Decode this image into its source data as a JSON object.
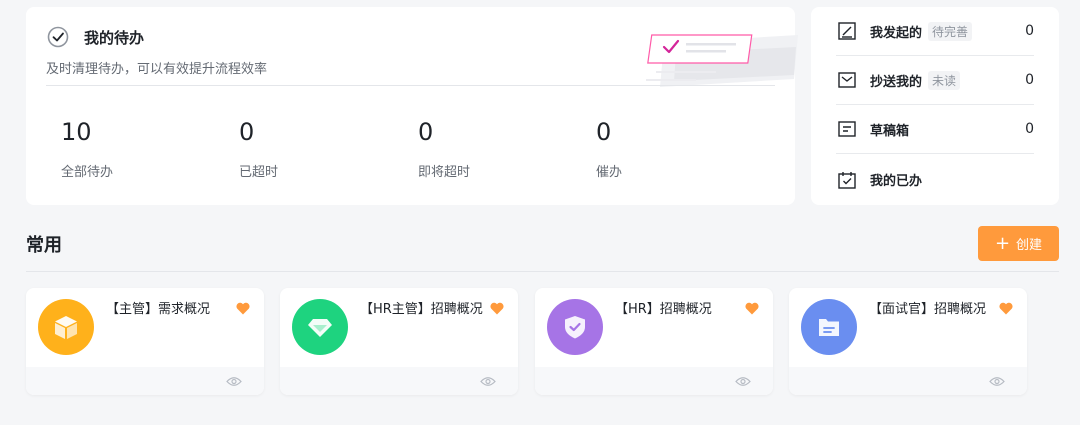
{
  "todo": {
    "title": "我的待办",
    "subtitle": "及时清理待办，可以有效提升流程效率",
    "stats": [
      {
        "value": "10",
        "label": "全部待办"
      },
      {
        "value": "0",
        "label": "已超时"
      },
      {
        "value": "0",
        "label": "即将超时"
      },
      {
        "value": "0",
        "label": "催办"
      }
    ]
  },
  "side": {
    "items": [
      {
        "label": "我发起的",
        "tag": "待完善",
        "count": "0",
        "icon": "edit-icon"
      },
      {
        "label": "抄送我的",
        "tag": "未读",
        "count": "0",
        "icon": "mail-icon"
      },
      {
        "label": "草稿箱",
        "tag": "",
        "count": "0",
        "icon": "draft-icon"
      },
      {
        "label": "我的已办",
        "tag": "",
        "count": "",
        "icon": "calendar-check-icon"
      }
    ]
  },
  "section": {
    "title": "常用",
    "create_label": "创建"
  },
  "apps": [
    {
      "name": "【主管】需求概况",
      "icon": "box-icon",
      "color": "#ffb11b"
    },
    {
      "name": "【HR主管】招聘概况",
      "icon": "diamond-icon",
      "color": "#1ed37f"
    },
    {
      "name": "【HR】招聘概况",
      "icon": "shield-icon",
      "color": "#a674e6"
    },
    {
      "name": "【面试官】招聘概况",
      "icon": "folder-icon",
      "color": "#6a8ef0"
    }
  ],
  "colors": {
    "accent": "#ff9a3c",
    "favorite": "#ff9a3c"
  }
}
